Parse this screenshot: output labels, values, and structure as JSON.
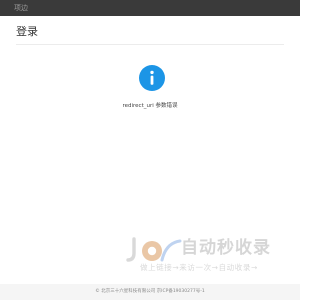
{
  "header": {
    "brand": "项边"
  },
  "main": {
    "title": "登录",
    "message": "redirect_uri 参数错误"
  },
  "icon": {
    "name": "info-icon",
    "color": "#1c95e6"
  },
  "watermark": {
    "title": "自动秒收录",
    "slogan": "做上链接→来访一次→自动收录→"
  },
  "footer": {
    "text": "© 北京三十六星科技有限公司 京ICP备19030277号-1"
  }
}
